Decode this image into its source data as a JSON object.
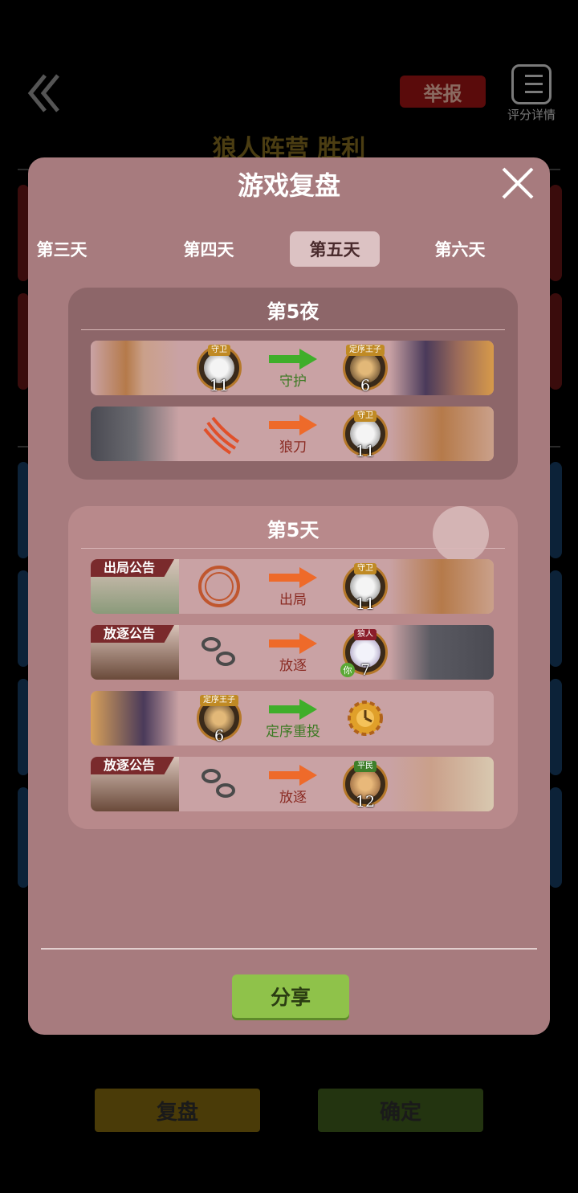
{
  "background": {
    "report_label": "举报",
    "score_detail_label": "评分详情",
    "camp_result": "狼人阵营 胜利",
    "replay_label": "复盘",
    "confirm_label": "确定"
  },
  "modal": {
    "title": "游戏复盘",
    "tabs": [
      {
        "label": "第三天"
      },
      {
        "label": "第四天"
      },
      {
        "label": "第五天"
      },
      {
        "label": "第六天"
      }
    ],
    "night": {
      "title": "第5夜",
      "rows": [
        {
          "actor_role": "守卫",
          "actor_num": "11",
          "action": "守护",
          "target_role": "定序王子",
          "target_num": "6"
        },
        {
          "action": "狼刀",
          "target_role": "守卫",
          "target_num": "11"
        }
      ]
    },
    "day": {
      "title": "第5天",
      "rows": [
        {
          "tag": "出局公告",
          "action": "出局",
          "target_role": "守卫",
          "target_num": "11"
        },
        {
          "tag": "放逐公告",
          "action": "放逐",
          "target_role": "狼人",
          "target_num": "7",
          "you": "你"
        },
        {
          "actor_role": "定序王子",
          "actor_num": "6",
          "action": "定序重投"
        },
        {
          "tag": "放逐公告",
          "action": "放逐",
          "target_role": "平民",
          "target_num": "12"
        }
      ]
    },
    "share_label": "分享"
  },
  "colors": {
    "modal_bg": "#a77b7e",
    "night_section": "#8d6669",
    "day_section": "#b8898b",
    "arrow_green": "#3fae2a",
    "arrow_orange": "#ee6a2a",
    "share_green": "#8fc24a"
  },
  "icons": [
    "back-chevron-icon",
    "list-icon",
    "close-icon",
    "arrow-right-icon",
    "claw-icon",
    "chains-icon",
    "gear-clock-icon",
    "stamp-icon"
  ]
}
